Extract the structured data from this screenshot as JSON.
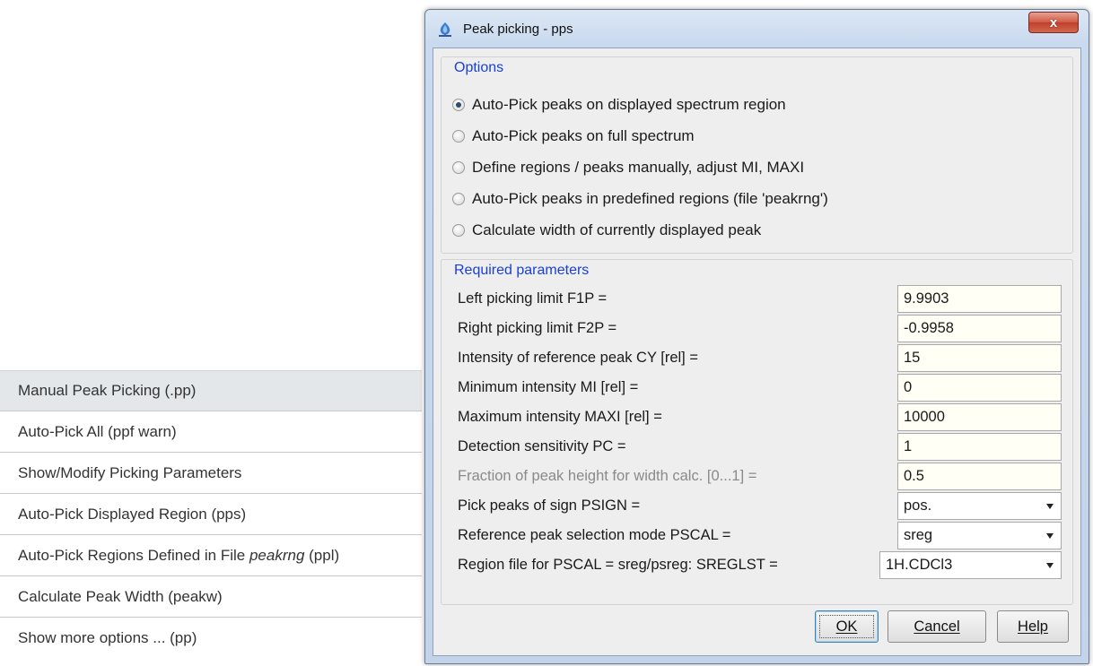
{
  "menu": {
    "items": [
      {
        "label": "Manual Peak Picking (.pp)",
        "selected": true
      },
      {
        "label": "Auto-Pick All (ppf warn)"
      },
      {
        "label": "Show/Modify Picking Parameters"
      },
      {
        "label": "Auto-Pick Displayed Region (pps)"
      },
      {
        "label_prefix": "Auto-Pick Regions Defined in File ",
        "label_italic": "peakrng",
        "label_suffix": " (ppl)"
      },
      {
        "label": "Calculate Peak Width (peakw)"
      },
      {
        "label": "Show more options ... (pp)"
      }
    ]
  },
  "dialog": {
    "title": "Peak picking - pps",
    "close_glyph": "x",
    "options": {
      "title": "Options",
      "radios": [
        {
          "label": "Auto-Pick peaks on displayed spectrum region",
          "checked": true
        },
        {
          "label": "Auto-Pick peaks on full spectrum",
          "checked": false
        },
        {
          "label": "Define regions / peaks manually, adjust MI, MAXI",
          "checked": false
        },
        {
          "label": "Auto-Pick peaks in predefined regions (file 'peakrng')",
          "checked": false
        },
        {
          "label": "Calculate width of currently displayed peak",
          "checked": false
        }
      ]
    },
    "params": {
      "title": "Required parameters",
      "rows": [
        {
          "label": "Left picking limit F1P =",
          "value": "9.9903"
        },
        {
          "label": "Right picking limit F2P =",
          "value": "-0.9958"
        },
        {
          "label": "Intensity of reference peak CY [rel] =",
          "value": "15"
        },
        {
          "label": "Minimum intensity MI [rel] =",
          "value": "0"
        },
        {
          "label": "Maximum intensity MAXI [rel] =",
          "value": "10000"
        },
        {
          "label": "Detection sensitivity PC =",
          "value": "1"
        },
        {
          "label": "Fraction of peak height for width calc. [0...1] =",
          "value": "0.5",
          "disabled": true
        },
        {
          "label": "Pick peaks of sign PSIGN =",
          "value": "pos.",
          "type": "select"
        },
        {
          "label": "Reference peak selection mode PSCAL =",
          "value": "sreg",
          "type": "select"
        },
        {
          "label": "Region file for PSCAL = sreg/psreg: SREGLST =",
          "value": "1H.CDCl3",
          "type": "select"
        }
      ]
    },
    "buttons": {
      "ok": "OK",
      "cancel": "Cancel",
      "help": "Help"
    }
  },
  "colors": {
    "group_title": "#1a3fd6",
    "close_button": "#c0402b",
    "menu_selected": "#e4e7ea"
  }
}
